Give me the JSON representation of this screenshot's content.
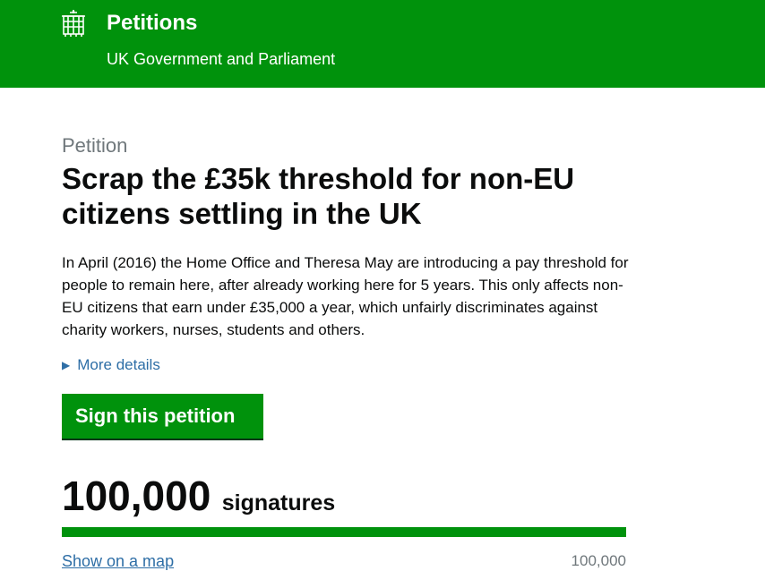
{
  "header": {
    "site_title": "Petitions",
    "site_subtitle": "UK Government and Parliament",
    "logo_icon": "portcullis-icon"
  },
  "petition": {
    "label": "Petition",
    "title": "Scrap the £35k threshold for non-EU citizens settling in the UK",
    "summary": "In April (2016) the Home Office and Theresa May are introducing a pay threshold for people to remain here, after already working here for 5 years. This only affects non-EU citizens that earn under £35,000 a year, which unfairly discriminates against charity workers, nurses, students and others.",
    "more_details": "More details",
    "sign_label": "Sign this petition"
  },
  "signatures": {
    "count": "100,000",
    "word": "signatures",
    "progress_fraction": 1.0,
    "map_link": "Show on a map",
    "threshold": "100,000"
  },
  "colors": {
    "brand_green": "#00920c",
    "link_blue": "#2e6ea6",
    "muted_grey": "#6f777b"
  }
}
